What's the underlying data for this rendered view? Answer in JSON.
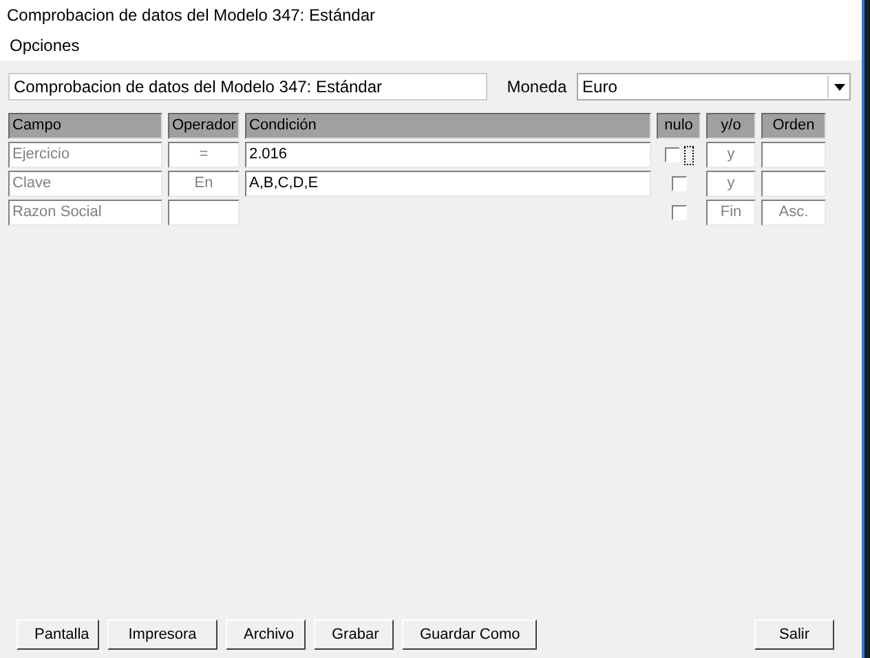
{
  "window": {
    "title": "Comprobacion de datos del Modelo 347: Estándar"
  },
  "menu": [
    "Opciones"
  ],
  "description": {
    "value": "Comprobacion de datos del Modelo 347: Estándar"
  },
  "currency": {
    "label": "Moneda",
    "value": "Euro"
  },
  "table": {
    "columns": [
      "Campo",
      "Operador",
      "Condición",
      "nulo",
      "y/o",
      "Orden"
    ],
    "rows": [
      {
        "campo": "Ejercicio",
        "operador": "=",
        "condicion": "2.016",
        "nulo": false,
        "focused": true,
        "yo": "y",
        "orden": ""
      },
      {
        "campo": "Clave",
        "operador": "En",
        "condicion": "A,B,C,D,E",
        "nulo": false,
        "focused": false,
        "yo": "y",
        "orden": ""
      },
      {
        "campo": "Razon Social",
        "operador": "",
        "nulo": false,
        "focused": false,
        "yo": "Fin",
        "orden": "Asc."
      }
    ]
  },
  "buttons": [
    {
      "label": "Pantalla"
    },
    {
      "label": "Impresora"
    },
    {
      "label": "Archivo"
    },
    {
      "label": "Grabar"
    },
    {
      "label": "Guardar Como"
    }
  ],
  "exit_button": {
    "label": "Salir"
  }
}
